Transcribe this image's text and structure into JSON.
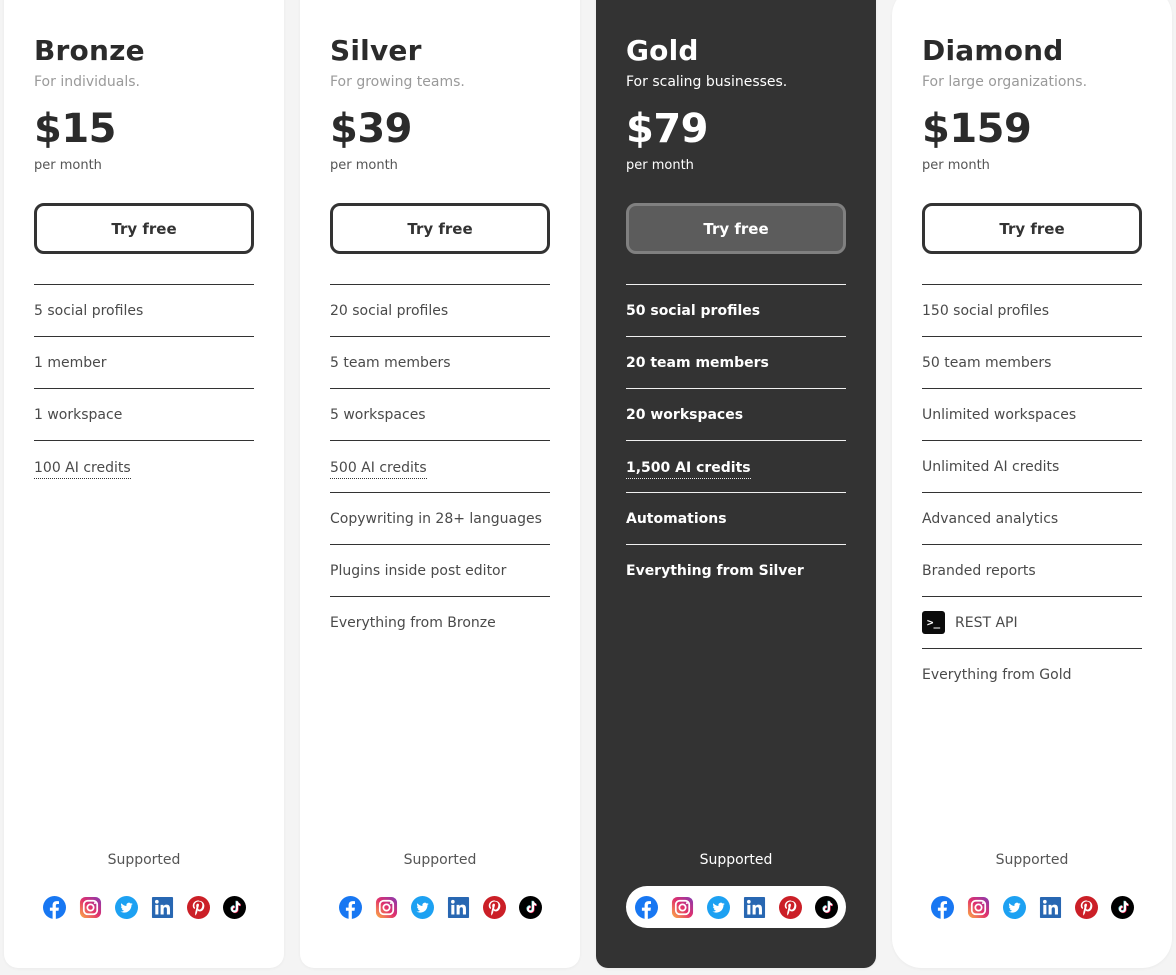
{
  "supported_label": "Supported",
  "social_networks": [
    "facebook",
    "instagram",
    "twitter",
    "linkedin",
    "pinterest",
    "tiktok"
  ],
  "plans": [
    {
      "name": "Bronze",
      "description": "For individuals.",
      "price": "$15",
      "period": "per month",
      "cta_label": "Try free",
      "highlighted": false,
      "features": [
        {
          "label": "5 social profiles"
        },
        {
          "label": "1 member"
        },
        {
          "label": "1 workspace"
        },
        {
          "label": "100 AI credits",
          "tooltip": true
        }
      ]
    },
    {
      "name": "Silver",
      "description": "For growing teams.",
      "price": "$39",
      "period": "per month",
      "cta_label": "Try free",
      "highlighted": false,
      "features": [
        {
          "label": "20 social profiles"
        },
        {
          "label": "5 team members"
        },
        {
          "label": "5 workspaces"
        },
        {
          "label": "500 AI credits",
          "tooltip": true
        },
        {
          "label": "Copywriting in 28+ languages"
        },
        {
          "label": "Plugins inside post editor"
        },
        {
          "label": "Everything from Bronze"
        }
      ]
    },
    {
      "name": "Gold",
      "description": "For scaling businesses.",
      "price": "$79",
      "period": "per month",
      "cta_label": "Try free",
      "highlighted": true,
      "features": [
        {
          "label": "50 social profiles"
        },
        {
          "label": "20 team members"
        },
        {
          "label": "20 workspaces"
        },
        {
          "label": "1,500 AI credits",
          "tooltip": true
        },
        {
          "label": "Automations"
        },
        {
          "label": "Everything from Silver"
        }
      ]
    },
    {
      "name": "Diamond",
      "description": "For large organizations.",
      "price": "$159",
      "period": "per month",
      "cta_label": "Try free",
      "highlighted": false,
      "features": [
        {
          "label": "150 social profiles"
        },
        {
          "label": "50 team members"
        },
        {
          "label": "Unlimited workspaces"
        },
        {
          "label": "Unlimited AI credits"
        },
        {
          "label": "Advanced analytics"
        },
        {
          "label": "Branded reports"
        },
        {
          "label": "REST API",
          "icon": "terminal-icon",
          "icon_glyph": ">_"
        },
        {
          "label": "Everything from Gold"
        }
      ]
    }
  ],
  "colors": {
    "page_bg": "#f4f4f4",
    "card_bg": "#ffffff",
    "highlight_card_bg": "#333333",
    "text_dark": "#2b2b2b",
    "facebook": "#1877f2",
    "twitter": "#1da1f2",
    "linkedin": "#2867b2",
    "pinterest": "#cb1f27",
    "tiktok": "#000000"
  }
}
